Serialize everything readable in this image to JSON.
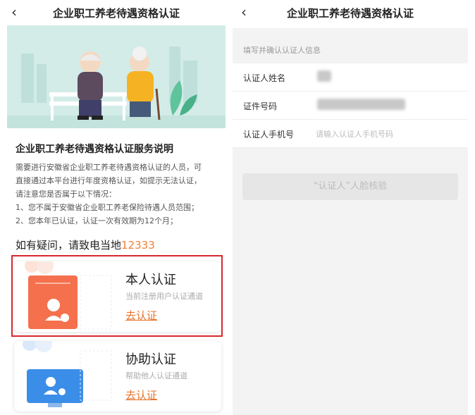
{
  "left": {
    "title": "企业职工养老待遇资格认证",
    "back_icon": "‹",
    "desc_title": "企业职工养老待遇资格认证服务说明",
    "desc_lines": [
      "需要进行安徽省企业职工养老待遇资格认证的人员，可",
      "直接通过本平台进行年度资格认证，如提示无法认证，",
      "请注意您是否属于以下情况：",
      "1、您不属于安徽省企业职工养老保险待遇人员范围；",
      "2、您本年已认证，认证一次有效期为12个月；"
    ],
    "hotline_prefix": "如有疑问，请致电当地",
    "hotline_number": "12333",
    "cards": [
      {
        "title": "本人认证",
        "subtitle": "当前注册用户认证通道",
        "link": "去认证"
      },
      {
        "title": "协助认证",
        "subtitle": "帮助他人认证通道",
        "link": "去认证"
      }
    ]
  },
  "right": {
    "title": "企业职工养老待遇资格认证",
    "back_icon": "‹",
    "section_hint": "填写并确认认证人信息",
    "fields": [
      {
        "label": "认证人姓名"
      },
      {
        "label": "证件号码"
      },
      {
        "label": "认证人手机号",
        "placeholder": "请输入认证人手机号码"
      }
    ],
    "face_button": "“认证人”人脸核验"
  },
  "colors": {
    "accent": "#f08037",
    "link": "#e9722a",
    "highlight": "#d8282e",
    "banner_bg": "#d3ece8"
  }
}
